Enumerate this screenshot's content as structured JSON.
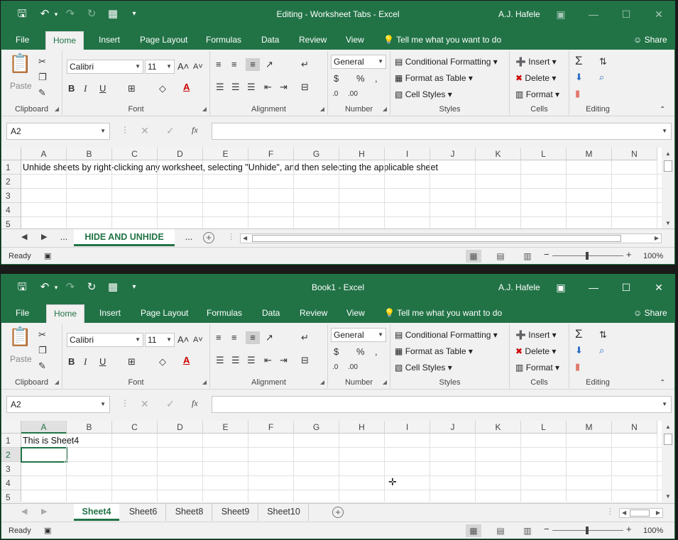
{
  "window1": {
    "title": "Editing - Worksheet Tabs  -  Excel",
    "user": "A.J. Hafele",
    "name_box": "A2",
    "rows": [
      "1",
      "2",
      "3",
      "4",
      "5"
    ],
    "cell_a1": "Unhide sheets by right-clicking any worksheet, selecting \"Unhide\", and then selecting the applicable sheet",
    "sheet_tabs": [
      {
        "label": "...",
        "active": false
      },
      {
        "label": "HIDE AND UNHIDE",
        "active": true
      },
      {
        "label": "...",
        "active": false
      }
    ],
    "status": "Ready",
    "zoom": "100%"
  },
  "window2": {
    "title": "Book1  -  Excel",
    "user": "A.J. Hafele",
    "name_box": "A2",
    "rows": [
      "1",
      "2",
      "3",
      "4",
      "5"
    ],
    "cell_a1": "This is Sheet4",
    "sheet_tabs": [
      {
        "label": "Sheet4",
        "active": true
      },
      {
        "label": "Sheet6",
        "active": false
      },
      {
        "label": "Sheet8",
        "active": false
      },
      {
        "label": "Sheet9",
        "active": false
      },
      {
        "label": "Sheet10",
        "active": false
      }
    ],
    "status": "Ready",
    "zoom": "100%"
  },
  "ribbon_tabs": [
    "File",
    "Home",
    "Insert",
    "Page Layout",
    "Formulas",
    "Data",
    "Review",
    "View"
  ],
  "tell_me": "Tell me what you want to do",
  "share": "Share",
  "groups": {
    "clipboard": "Clipboard",
    "font": "Font",
    "alignment": "Alignment",
    "number": "Number",
    "styles": "Styles",
    "cells": "Cells",
    "editing": "Editing"
  },
  "paste_label": "Paste",
  "font_name": "Calibri",
  "font_size": "11",
  "number_format": "General",
  "styles_buttons": [
    "Conditional Formatting",
    "Format as Table",
    "Cell Styles"
  ],
  "cells_buttons": [
    "Insert",
    "Delete",
    "Format"
  ],
  "columns": [
    "A",
    "B",
    "C",
    "D",
    "E",
    "F",
    "G",
    "H",
    "I",
    "J",
    "K",
    "L",
    "M",
    "N"
  ],
  "icons": {
    "save": "save-icon",
    "undo": "undo-icon",
    "redo": "redo-icon",
    "autosum": "autosum-icon"
  },
  "colors": {
    "accent": "#217346"
  }
}
